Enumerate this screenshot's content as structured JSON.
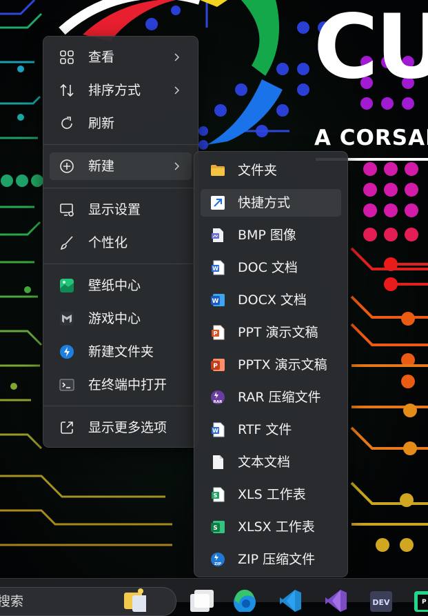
{
  "desktop": {
    "brand_wordmark": "CU",
    "brand_tagline": "A CORSAI"
  },
  "main_menu": {
    "items": [
      {
        "label": "查看",
        "icon": "view-grid-icon",
        "has_submenu": true
      },
      {
        "label": "排序方式",
        "icon": "sort-icon",
        "has_submenu": true
      },
      {
        "label": "刷新",
        "icon": "refresh-icon",
        "has_submenu": false
      },
      {
        "label": "新建",
        "icon": "new-plus-icon",
        "has_submenu": true,
        "highlighted": true
      },
      {
        "label": "显示设置",
        "icon": "display-settings-icon",
        "has_submenu": false
      },
      {
        "label": "个性化",
        "icon": "personalize-brush-icon",
        "has_submenu": false
      },
      {
        "label": "壁纸中心",
        "icon": "wallpaper-center-icon",
        "has_submenu": false
      },
      {
        "label": "游戏中心",
        "icon": "game-center-icon",
        "has_submenu": false
      },
      {
        "label": "新建文件夹",
        "icon": "new-folder-app-icon",
        "has_submenu": false
      },
      {
        "label": "在终端中打开",
        "icon": "terminal-icon",
        "has_submenu": false
      },
      {
        "label": "显示更多选项",
        "icon": "more-options-icon",
        "has_submenu": false
      }
    ]
  },
  "new_submenu": {
    "items": [
      {
        "label": "文件夹",
        "icon": "folder-icon"
      },
      {
        "label": "快捷方式",
        "icon": "shortcut-icon",
        "highlighted": true
      },
      {
        "label": "BMP 图像",
        "icon": "bmp-image-icon"
      },
      {
        "label": "DOC 文档",
        "icon": "word-doc-icon"
      },
      {
        "label": "DOCX 文档",
        "icon": "word-docx-icon"
      },
      {
        "label": "PPT 演示文稿",
        "icon": "ppt-icon"
      },
      {
        "label": "PPTX 演示文稿",
        "icon": "pptx-icon"
      },
      {
        "label": "RAR 压缩文件",
        "icon": "rar-archive-icon"
      },
      {
        "label": "RTF 文件",
        "icon": "rtf-file-icon"
      },
      {
        "label": "文本文档",
        "icon": "text-document-icon"
      },
      {
        "label": "XLS 工作表",
        "icon": "xls-icon"
      },
      {
        "label": "XLSX 工作表",
        "icon": "xlsx-icon"
      },
      {
        "label": "ZIP 压缩文件",
        "icon": "zip-archive-icon"
      }
    ]
  },
  "taskbar": {
    "search_text": "搜索",
    "apps": [
      "file-explorer-icon",
      "task-view-icon",
      "edge-icon",
      "vscode-icon",
      "visual-studio-icon",
      "dev-home-icon",
      "pycharm-icon"
    ]
  },
  "colors": {
    "menu_bg": "#2c2e32",
    "word_blue": "#2b6fd6",
    "ppt_orange": "#d9582b",
    "excel_green": "#21a366",
    "folder_yellow": "#f6c443",
    "accent_blue": "#4aa3f0"
  }
}
